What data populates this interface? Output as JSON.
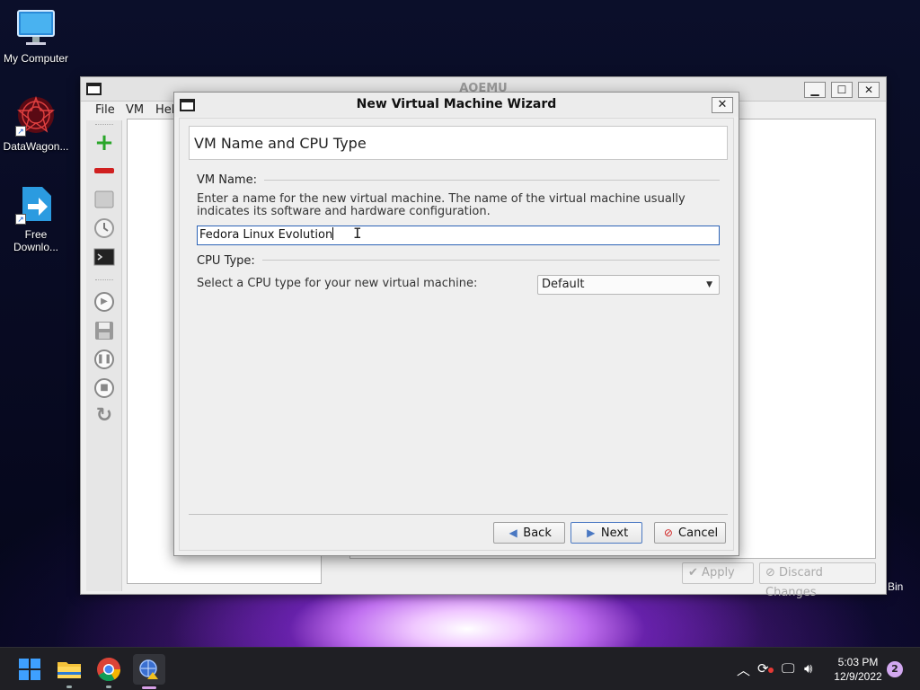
{
  "desktop": {
    "icons": [
      {
        "label": "My Computer"
      },
      {
        "label": "DataWagon..."
      },
      {
        "label": "Free Downlo..."
      }
    ],
    "bin_label": "Bin"
  },
  "main_window": {
    "title": "AOEMU",
    "menu": {
      "file": "File",
      "vm": "VM",
      "help": "Help"
    },
    "buttons": {
      "apply": "Apply",
      "discard": "Discard Changes"
    }
  },
  "dialog": {
    "title": "New Virtual Machine Wizard",
    "close_glyph": "✕",
    "page_title": "VM Name and CPU Type",
    "vm_name_section": "VM Name:",
    "vm_name_description": "Enter a name for the new virtual machine. The name of the virtual machine usually indicates its software and hardware configuration.",
    "vm_name_value": "Fedora Linux Evolution",
    "cpu_section": "CPU Type:",
    "cpu_description": "Select a CPU type for your new virtual machine:",
    "cpu_selected": "Default",
    "buttons": {
      "back": "Back",
      "next": "Next",
      "cancel": "Cancel"
    }
  },
  "taskbar": {
    "time": "5:03 PM",
    "date": "12/9/2022",
    "notification_count": "2",
    "apps": [
      "start-icon",
      "file-explorer-icon",
      "chrome-icon",
      "aoemu-icon"
    ]
  }
}
